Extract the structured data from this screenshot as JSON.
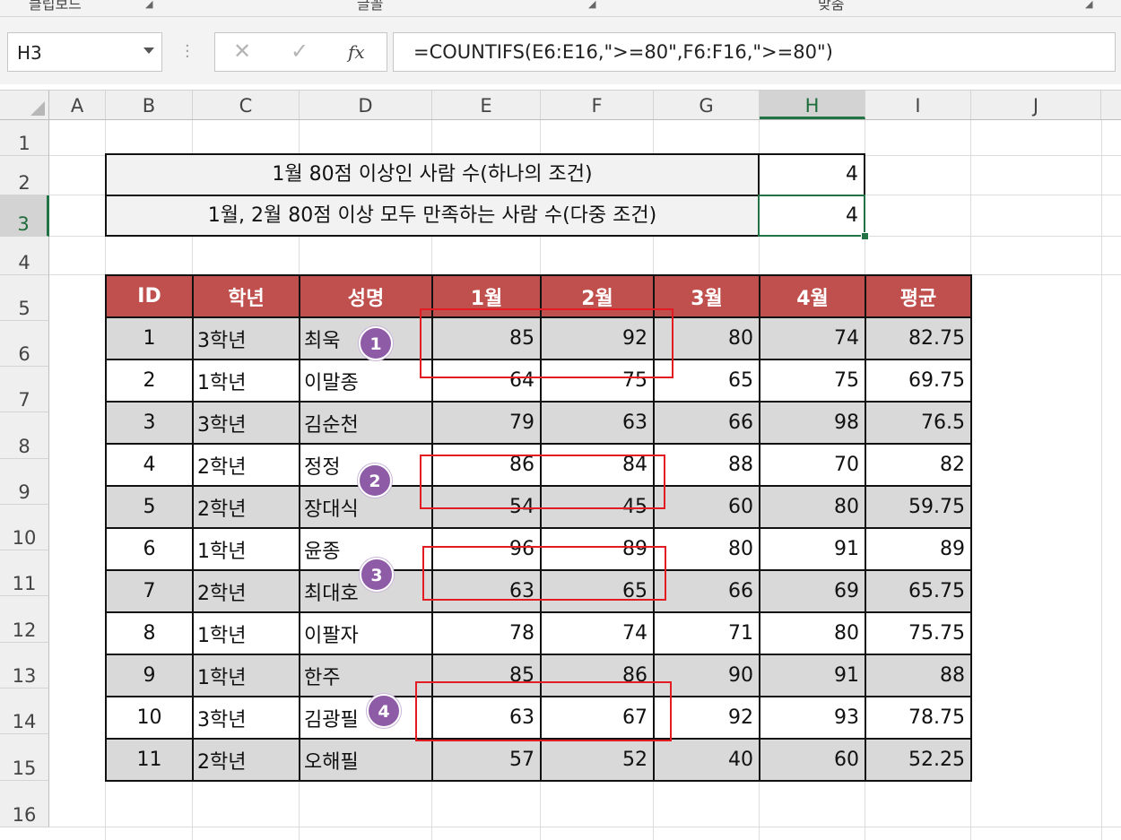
{
  "ribbon": {
    "groups": [
      "클립보드",
      "글꼴",
      "맞춤"
    ]
  },
  "formula_bar": {
    "name_box": "H3",
    "formula": "=COUNTIFS(E6:E16,\">=80\",F6:F16,\">=80\")",
    "cancel_glyph": "✕",
    "enter_glyph": "✓",
    "fx_label": "fx"
  },
  "columns": [
    "A",
    "B",
    "C",
    "D",
    "E",
    "F",
    "G",
    "H",
    "I",
    "J"
  ],
  "active_column": "H",
  "rows": [
    "1",
    "2",
    "3",
    "4",
    "5",
    "6",
    "7",
    "8",
    "9",
    "10",
    "11",
    "12",
    "13",
    "14",
    "15",
    "16"
  ],
  "active_row": "3",
  "summary": {
    "row2_label": "1월 80점 이상인 사람 수(하나의 조건)",
    "row2_value": "4",
    "row3_label": "1월, 2월 80점 이상 모두 만족하는 사람 수(다중 조건)",
    "row3_value": "4"
  },
  "table": {
    "headers": [
      "ID",
      "학년",
      "성명",
      "1월",
      "2월",
      "3월",
      "4월",
      "평균"
    ],
    "rows": [
      [
        "1",
        "3학년",
        "최욱",
        "85",
        "92",
        "80",
        "74",
        "82.75"
      ],
      [
        "2",
        "1학년",
        "이말종",
        "64",
        "75",
        "65",
        "75",
        "69.75"
      ],
      [
        "3",
        "3학년",
        "김순천",
        "79",
        "63",
        "66",
        "98",
        "76.5"
      ],
      [
        "4",
        "2학년",
        "정정",
        "86",
        "84",
        "88",
        "70",
        "82"
      ],
      [
        "5",
        "2학년",
        "장대식",
        "54",
        "45",
        "60",
        "80",
        "59.75"
      ],
      [
        "6",
        "1학년",
        "윤종",
        "96",
        "89",
        "80",
        "91",
        "89"
      ],
      [
        "7",
        "2학년",
        "최대호",
        "63",
        "65",
        "66",
        "69",
        "65.75"
      ],
      [
        "8",
        "1학년",
        "이팔자",
        "78",
        "74",
        "71",
        "80",
        "75.75"
      ],
      [
        "9",
        "1학년",
        "한주",
        "85",
        "86",
        "90",
        "91",
        "88"
      ],
      [
        "10",
        "3학년",
        "김광필",
        "63",
        "67",
        "92",
        "93",
        "78.75"
      ],
      [
        "11",
        "2학년",
        "오해필",
        "57",
        "52",
        "40",
        "60",
        "52.25"
      ]
    ]
  },
  "badges": [
    "1",
    "2",
    "3",
    "4"
  ],
  "colors": {
    "header_fill": "#c0504d",
    "shaded_row": "#d9d9d9",
    "highlight_box": "#e31b23",
    "badge": "#8e5ba6",
    "excel_green": "#217346"
  }
}
